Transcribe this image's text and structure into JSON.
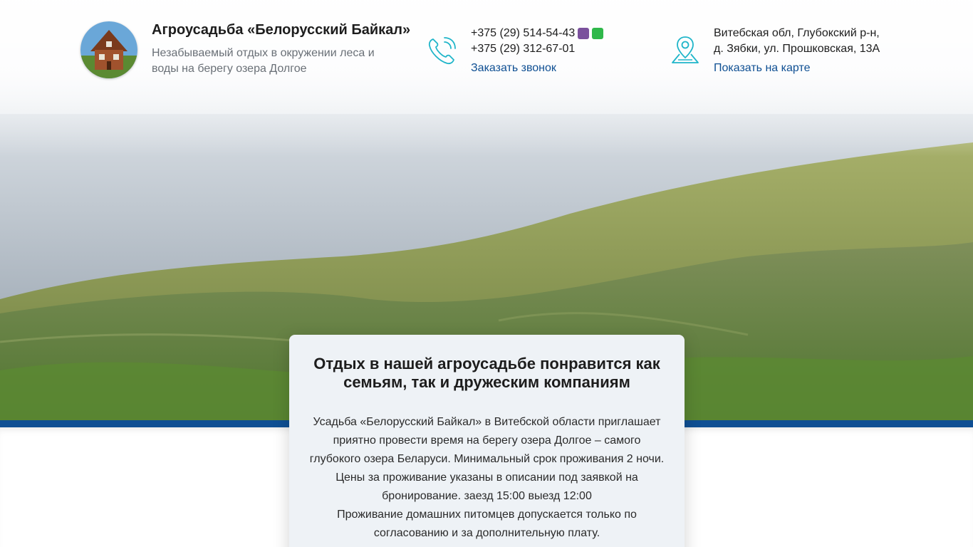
{
  "header": {
    "logo_icon": "house-photo-logo",
    "title": "Агроусадьба «Белорусский Байкал»",
    "subtitle": "Незабываемый отдых в окружении леса и воды на берегу озера Долгое"
  },
  "contacts": {
    "phone_icon": "phone-icon",
    "phone1": "+375 (29) 514-54-43",
    "phone2": "+375 (29) 312-67-01",
    "messenger_icons": [
      "viber-icon",
      "whatsapp-icon"
    ],
    "callback_label": "Заказать звонок"
  },
  "address": {
    "map_icon": "map-pin-icon",
    "line1": "Витебская обл, Глубокский р-н,",
    "line2": "д. Зябки, ул. Прошковская, 13А",
    "map_link": "Показать на карте"
  },
  "card": {
    "title": "Отдых в нашей агроусадьбе понравится как семьям, так и дружеским компаниям",
    "text1": "Усадьба «Белорусский Байкал» в Витебской области приглашает приятно провести время на берегу озера Долгое – самого глубокого озера Беларуси. Минимальный срок проживания 2 ночи. Цены за проживание указаны в описании под заявкой на бронирование. заезд 15:00 выезд 12:00",
    "text2": "Проживание домашних питомцев допускается только по согласованию и за дополнительную плату."
  },
  "colors": {
    "accent_blue": "#0f4f93",
    "icon_teal": "#1fb5c9",
    "viber": "#7b519d",
    "whatsapp": "#2fb84a"
  }
}
